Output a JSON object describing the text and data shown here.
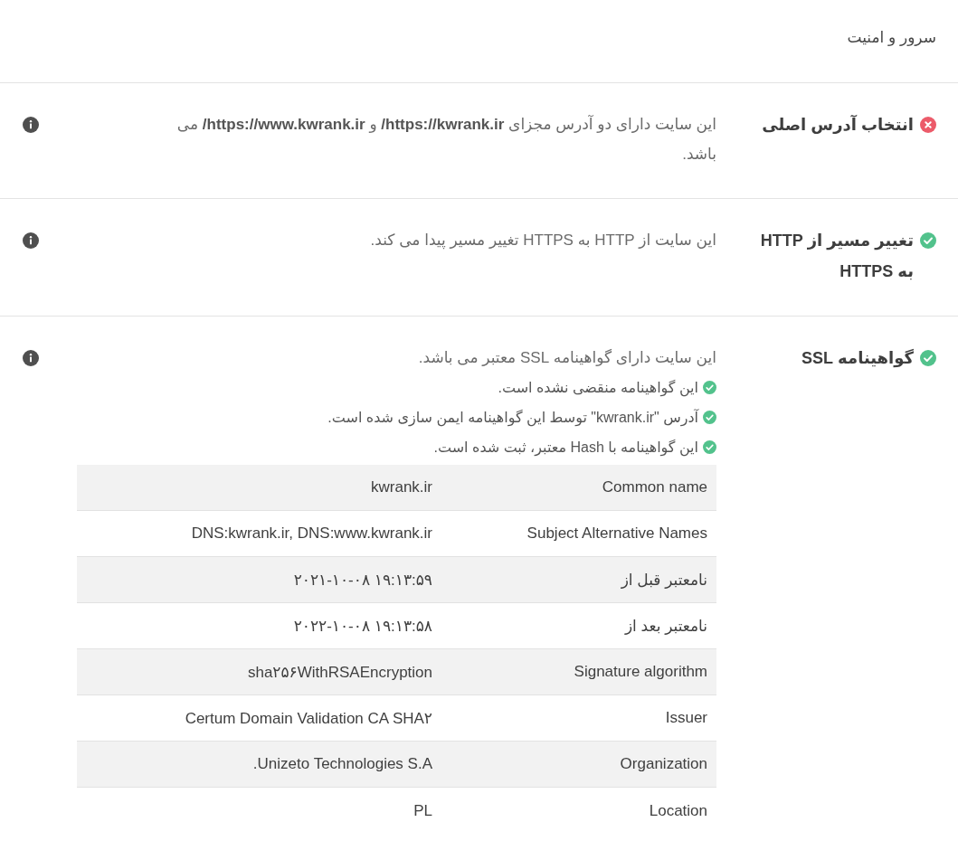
{
  "page": {
    "title": "سرور و امنیت"
  },
  "checks": [
    {
      "title": "انتخاب آدرس اصلی",
      "passed": false,
      "description": "این سایت دارای دو آدرس مجزای **https://kwrank.ir/** و **https://www.kwrank.ir/** می باشد."
    },
    {
      "title": "تغییر مسیر از HTTP به HTTPS",
      "passed": true,
      "description": "این سایت از HTTP به HTTPS تغییر مسیر پیدا می کند."
    },
    {
      "title": "گواهینامه SSL",
      "passed": true,
      "description": "این سایت دارای گواهینامه SSL معتبر می باشد.",
      "details": [
        {
          "text": "این گواهینامه منقضی نشده است.",
          "passed": true
        },
        {
          "text": "آدرس \"kwrank.ir\" توسط این گواهینامه ایمن سازی شده است.",
          "passed": true
        },
        {
          "text": "این گواهینامه با Hash معتبر، ثبت شده است.",
          "passed": true
        }
      ],
      "table": {
        "rows": [
          {
            "label": "Common name",
            "value": "kwrank.ir"
          },
          {
            "label": "Subject Alternative Names",
            "value": "DNS:kwrank.ir, DNS:www.kwrank.ir"
          },
          {
            "label": "نامعتبر قبل از",
            "value": "۱۹:۱۳:۵۹ ۲۰۲۱-۱۰-۰۸"
          },
          {
            "label": "نامعتبر بعد از",
            "value": "۱۹:۱۳:۵۸ ۲۰۲۲-۱۰-۰۸"
          },
          {
            "label": "Signature algorithm",
            "value": "sha۲۵۶WithRSAEncryption"
          },
          {
            "label": "Issuer",
            "value": "Certum Domain Validation CA SHA۲"
          },
          {
            "label": "Organization",
            "value": "Unizeto Technologies S.A."
          },
          {
            "label": "Location",
            "value": "PL"
          }
        ]
      }
    }
  ]
}
